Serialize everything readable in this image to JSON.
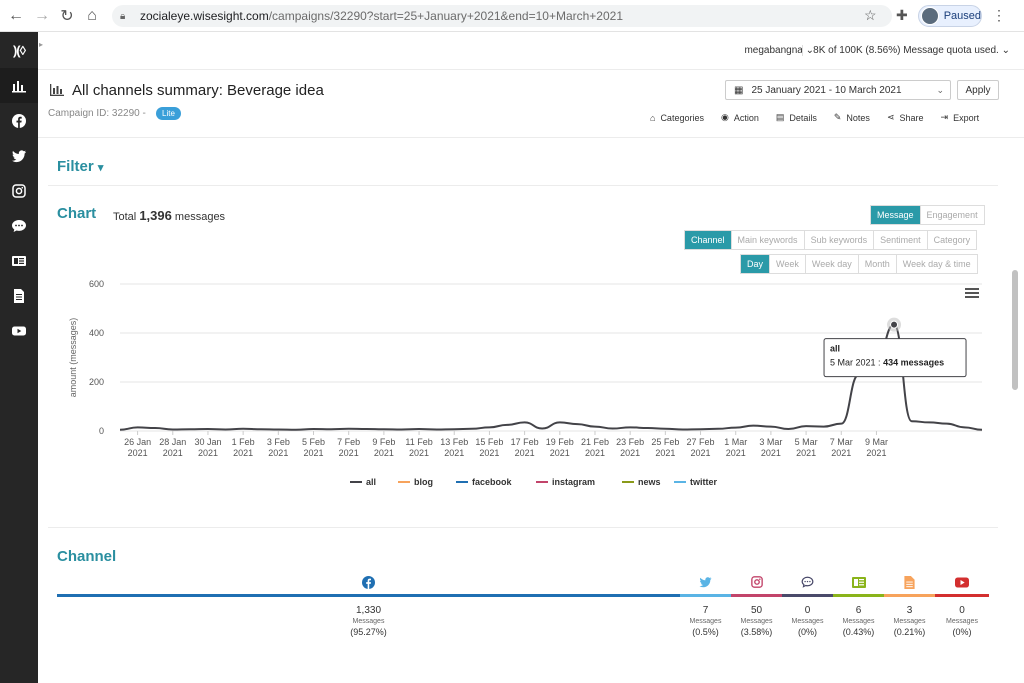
{
  "browser": {
    "url_host": "zocialeye.wisesight.com",
    "url_path": "/campaigns/32290?start=25+January+2021&end=10+March+2021",
    "profile_label": "Paused"
  },
  "topbar": {
    "user": "megabangna",
    "quota": "8K of 100K (8.56%) Message quota used."
  },
  "header": {
    "title": "All channels summary: Beverage idea",
    "campaign_id": "Campaign ID: 32290 -",
    "badge": "Lite",
    "date_range": "25 January 2021 - 10 March 2021",
    "apply_label": "Apply",
    "actions": [
      {
        "label": "Categories",
        "icon": "tag-icon"
      },
      {
        "label": "Action",
        "icon": "play-icon"
      },
      {
        "label": "Details",
        "icon": "document-icon"
      },
      {
        "label": "Notes",
        "icon": "pencil-icon"
      },
      {
        "label": "Share",
        "icon": "share-icon"
      },
      {
        "label": "Export",
        "icon": "export-icon"
      }
    ]
  },
  "filter": {
    "title": "Filter"
  },
  "chart_section": {
    "title": "Chart",
    "total_prefix": "Total",
    "total_value": "1,396",
    "total_suffix": "messages",
    "metric_toggle": [
      "Message",
      "Engagement"
    ],
    "metric_active": 0,
    "dimension_toggle": [
      "Channel",
      "Main keywords",
      "Sub keywords",
      "Sentiment",
      "Category"
    ],
    "dimension_active": 0,
    "period_toggle": [
      "Day",
      "Week",
      "Week day",
      "Month",
      "Week day & time"
    ],
    "period_active": 0,
    "tooltip": {
      "series": "all",
      "date": "5 Mar 2021",
      "sep": ":",
      "value": "434 messages"
    }
  },
  "chart_data": {
    "type": "line",
    "ylabel": "amount (messages)",
    "ylim": [
      0,
      600
    ],
    "yticks": [
      0,
      200,
      400,
      600
    ],
    "xtick_labels": [
      [
        "26 Jan",
        "2021"
      ],
      [
        "28 Jan",
        "2021"
      ],
      [
        "30 Jan",
        "2021"
      ],
      [
        "1 Feb",
        "2021"
      ],
      [
        "3 Feb",
        "2021"
      ],
      [
        "5 Feb",
        "2021"
      ],
      [
        "7 Feb",
        "2021"
      ],
      [
        "9 Feb",
        "2021"
      ],
      [
        "11 Feb",
        "2021"
      ],
      [
        "13 Feb",
        "2021"
      ],
      [
        "15 Feb",
        "2021"
      ],
      [
        "17 Feb",
        "2021"
      ],
      [
        "19 Feb",
        "2021"
      ],
      [
        "21 Feb",
        "2021"
      ],
      [
        "23 Feb",
        "2021"
      ],
      [
        "25 Feb",
        "2021"
      ],
      [
        "27 Feb",
        "2021"
      ],
      [
        "1 Mar",
        "2021"
      ],
      [
        "3 Mar",
        "2021"
      ],
      [
        "5 Mar",
        "2021"
      ],
      [
        "7 Mar",
        "2021"
      ],
      [
        "9 Mar",
        "2021"
      ]
    ],
    "x_start": "2021-01-25",
    "x_end": "2021-03-10",
    "legend": [
      {
        "name": "all",
        "color": "#434348"
      },
      {
        "name": "blog",
        "color": "#f7a35c"
      },
      {
        "name": "facebook",
        "color": "#1f6fb2"
      },
      {
        "name": "instagram",
        "color": "#c2446a"
      },
      {
        "name": "news",
        "color": "#8a9a1a"
      },
      {
        "name": "twitter",
        "color": "#5ab4e5"
      }
    ],
    "series": [
      {
        "name": "all",
        "values": [
          5,
          15,
          12,
          6,
          7,
          8,
          6,
          9,
          7,
          6,
          5,
          8,
          7,
          9,
          8,
          7,
          6,
          8,
          6,
          7,
          9,
          15,
          25,
          35,
          10,
          35,
          28,
          18,
          10,
          15,
          12,
          9,
          6,
          7,
          9,
          14,
          22,
          18,
          8,
          20,
          18,
          30,
          230,
          290,
          434,
          40,
          35,
          30,
          15,
          5
        ]
      }
    ]
  },
  "channel_section": {
    "title": "Channel",
    "columns": [
      {
        "icon": "facebook-icon",
        "color": "#1f6fb2",
        "count": "1,330",
        "label": "Messages",
        "pct": "(95.27%)"
      },
      {
        "icon": "twitter-icon",
        "color": "#5ab4e5",
        "count": "7",
        "label": "Messages",
        "pct": "(0.5%)"
      },
      {
        "icon": "instagram-icon",
        "color": "#c2446a",
        "count": "50",
        "label": "Messages",
        "pct": "(3.58%)"
      },
      {
        "icon": "forum-icon",
        "color": "#4a4a6a",
        "count": "0",
        "label": "Messages",
        "pct": "(0%)"
      },
      {
        "icon": "news-icon",
        "color": "#8ab41a",
        "count": "6",
        "label": "Messages",
        "pct": "(0.43%)"
      },
      {
        "icon": "blog-icon",
        "color": "#f7a35c",
        "count": "3",
        "label": "Messages",
        "pct": "(0.21%)"
      },
      {
        "icon": "youtube-icon",
        "color": "#d32f2f",
        "count": "0",
        "label": "Messages",
        "pct": "(0%)"
      }
    ]
  }
}
